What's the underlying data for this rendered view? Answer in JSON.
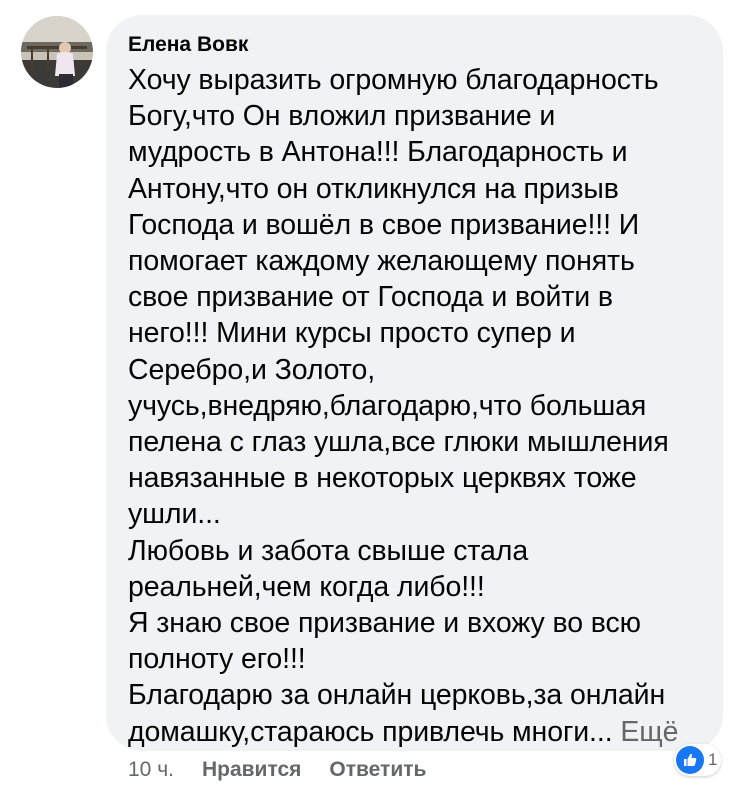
{
  "comment": {
    "author": "Елена Вовк",
    "text_lines": [
      "Хочу выразить огромную благодарность",
      "Богу,что Он вложил призвание и",
      "мудрость в Антона!!! Благодарность и",
      "Антону,что он откликнулся на призыв",
      "Господа и вошёл в свое призвание!!! И",
      "помогает каждому желающему понять",
      "свое призвание от Господа и войти в",
      "него!!!  Мини курсы просто супер и",
      "Серебро,и Золото,",
      "учусь,внедряю,благодарю,что большая",
      "пелена с глаз ушла,все глюки мышления",
      "навязанные в некоторых церквях тоже",
      "ушли...",
      "Любовь и забота свыше стала",
      "реальней,чем когда либо!!!",
      " Я знаю свое призвание и вхожу во всю",
      "полноту его!!!",
      " Благодарю за онлайн церковь,за онлайн",
      "домашку,стараюсь привлечь многи..."
    ],
    "see_more_label": "Ещё"
  },
  "actions": {
    "time": "10 ч.",
    "like_label": "Нравится",
    "reply_label": "Ответить"
  },
  "reactions": {
    "icon": "thumbs-up-icon",
    "count": "1"
  },
  "colors": {
    "bubble": "#f0f2f5",
    "text": "#050505",
    "secondary": "#65676b",
    "like_blue": "#1877f2"
  }
}
